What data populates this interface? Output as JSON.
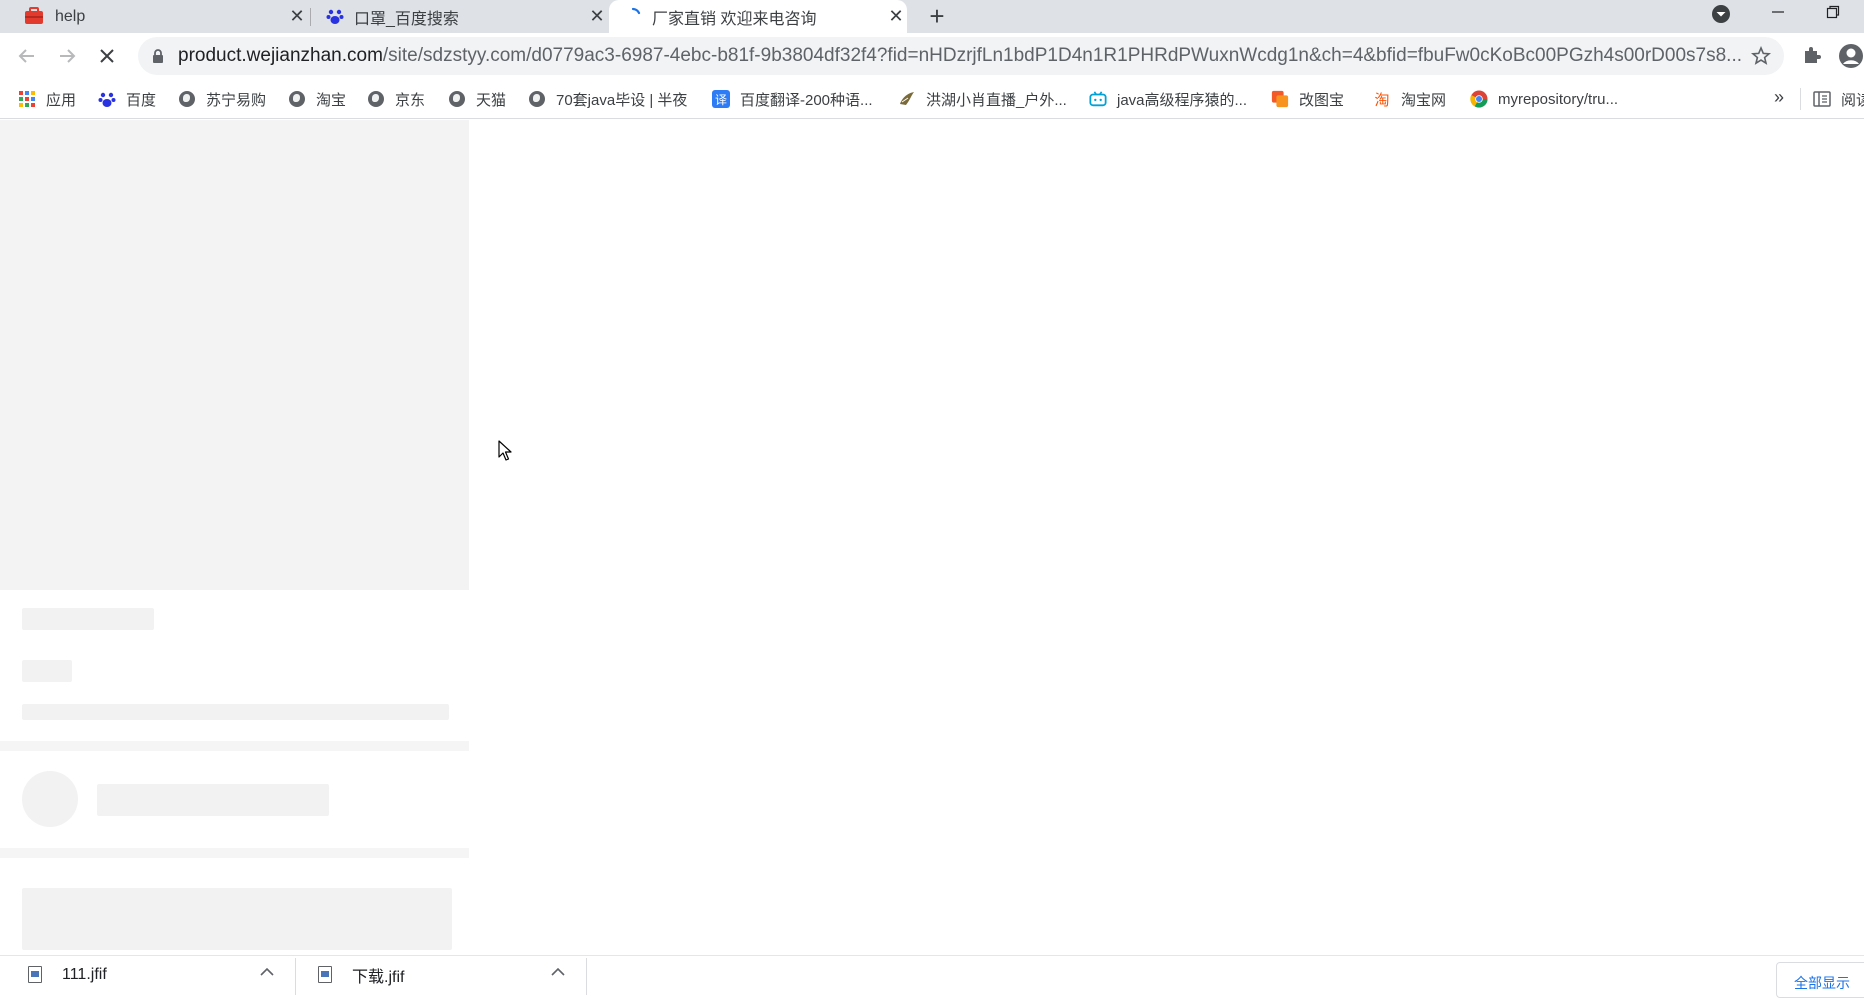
{
  "tabs": [
    {
      "title": "help",
      "icon": "toolbox-icon"
    },
    {
      "title": "口罩_百度搜索",
      "icon": "baidu-paw-icon"
    },
    {
      "title": "厂家直销 欢迎来电咨询",
      "icon": "loading-spinner-icon",
      "active": true
    }
  ],
  "toolbar": {
    "url_host": "product.wejianzhan.com",
    "url_rest": "/site/sdzstyy.com/d0779ac3-6987-4ebc-b81f-9b3804df32f4?fid=nHDzrjfLn1bdP1D4n1R1PHRdPWuxnWcdg1n&ch=4&bfid=fbuFw0cKoBc00PGzh4s00rD00s7s8..."
  },
  "bookmarks": [
    {
      "label": "应用",
      "icon": "apps-grid-icon"
    },
    {
      "label": "百度",
      "icon": "baidu-paw-icon"
    },
    {
      "label": "苏宁易购",
      "icon": "globe-icon"
    },
    {
      "label": "淘宝",
      "icon": "globe-icon"
    },
    {
      "label": "京东",
      "icon": "globe-icon"
    },
    {
      "label": "天猫",
      "icon": "globe-icon"
    },
    {
      "label": "70套java毕设 | 半夜",
      "icon": "globe-icon"
    },
    {
      "label": "百度翻译-200种语...",
      "icon": "translate-icon"
    },
    {
      "label": "洪湖小肖直播_户外...",
      "icon": "bird-icon"
    },
    {
      "label": "java高级程序猿的...",
      "icon": "bilibili-icon"
    },
    {
      "label": "改图宝",
      "icon": "gaitubao-icon"
    },
    {
      "label": "淘宝网",
      "icon": "taobao-icon"
    },
    {
      "label": "myrepository/tru...",
      "icon": "chrome-icon"
    }
  ],
  "bookmarks_more": "»",
  "reading_list": "阅读",
  "downloads": {
    "items": [
      {
        "name": "111.jfif"
      },
      {
        "name": "下载.jfif"
      }
    ],
    "show_all": "全部显示"
  },
  "colors": {
    "tabstrip_bg": "#dee1e6",
    "omnibox_bg": "#f1f3f4",
    "accent": "#1a73e8",
    "skeleton": "#f2f2f2"
  }
}
